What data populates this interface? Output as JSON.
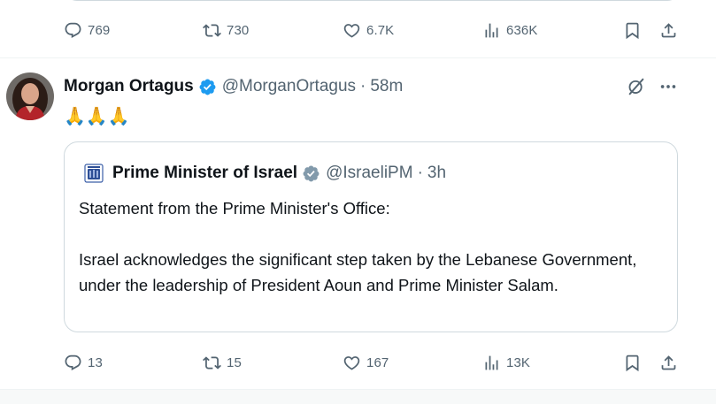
{
  "previous_post": {
    "actions": {
      "reply_count": "769",
      "repost_count": "730",
      "like_count": "6.7K",
      "view_count": "636K"
    }
  },
  "post": {
    "author_name": "Morgan Ortagus",
    "author_handle": "@MorganOrtagus",
    "separator": "·",
    "time": "58m",
    "text": "🙏🙏🙏",
    "quoted_post": {
      "author_name": "Prime Minister of Israel",
      "author_handle": "@IsraeliPM",
      "separator": "·",
      "time": "3h",
      "paragraphs": [
        "Statement from the Prime Minister's Office:",
        "Israel acknowledges the significant step taken by the Lebanese Government, under the leadership of President Aoun and Prime Minister Salam."
      ]
    },
    "actions": {
      "reply_count": "13",
      "repost_count": "15",
      "like_count": "167",
      "view_count": "13K"
    }
  },
  "icons": {
    "reply": "reply-icon",
    "repost": "repost-icon",
    "like": "heart-icon",
    "views": "views-icon",
    "bookmark": "bookmark-icon",
    "share": "share-icon",
    "verified": "verified-badge-icon",
    "grok": "grok-icon",
    "more": "more-icon"
  },
  "colors": {
    "verified_blue": "#1d9bf0",
    "verified_gray": "#829aab",
    "secondary_text": "#536471",
    "border": "#cfd9de"
  }
}
